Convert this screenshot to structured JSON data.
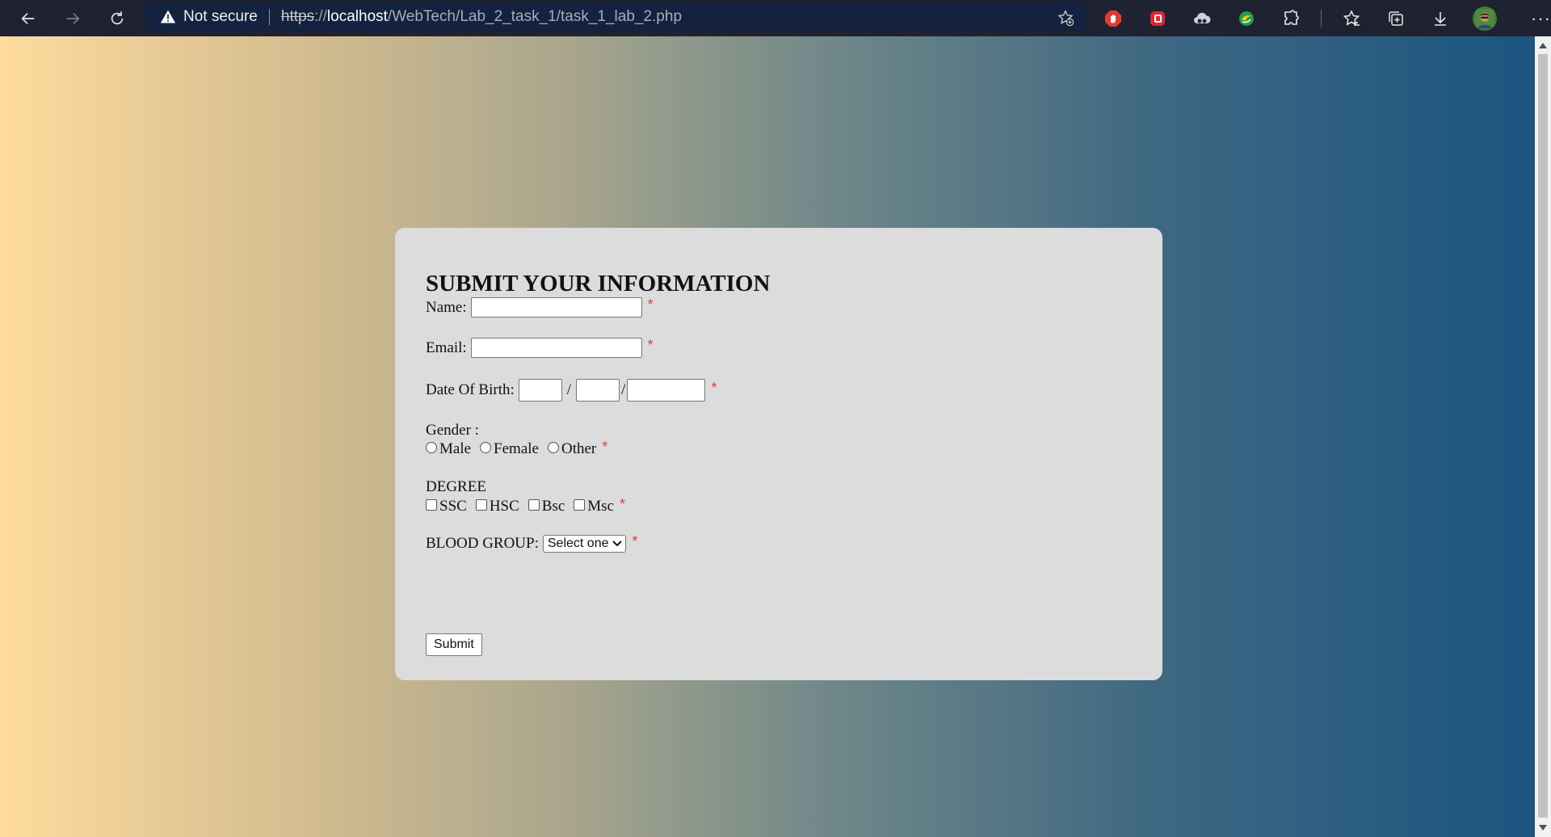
{
  "browser": {
    "security_label": "Not secure",
    "url": {
      "scheme": "https",
      "separator": "://",
      "host": "localhost",
      "path": "/WebTech/Lab_2_task_1/task_1_lab_2.php"
    },
    "more_label": "···"
  },
  "form": {
    "title": "SUBMIT YOUR INFORMATION",
    "name_label": "Name:",
    "email_label": "Email:",
    "dob_label": "Date Of Birth:",
    "dob_sep": "/",
    "gender_label": "Gender :",
    "gender_options": [
      "Male",
      "Female",
      "Other"
    ],
    "degree_label": "DEGREE",
    "degree_options": [
      "SSC",
      "HSC",
      "Bsc",
      "Msc"
    ],
    "blood_label": "BLOOD GROUP:",
    "blood_selected": "Select one",
    "required_mark": "*",
    "submit_label": "Submit"
  },
  "colors": {
    "required": "#e53935",
    "card_bg": "#dcdcdd",
    "gradient_start": "#ffdb9d",
    "gradient_end": "#1b5580"
  }
}
